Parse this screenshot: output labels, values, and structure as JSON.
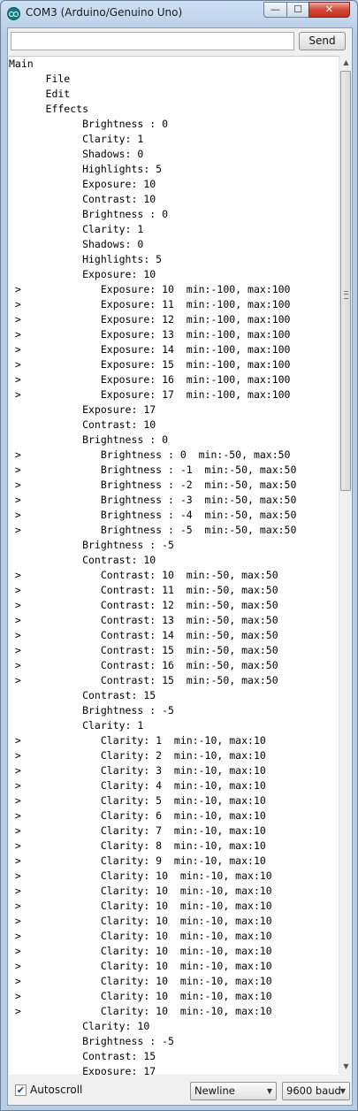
{
  "window": {
    "title": "COM3 (Arduino/Genuino Uno)",
    "controls": {
      "minimize": "—",
      "maximize": "☐",
      "close": "✕"
    }
  },
  "send": {
    "input_value": "",
    "button_label": "Send"
  },
  "console_lines": [
    "Main",
    "      File",
    "      Edit",
    "      Effects",
    "            Brightness : 0",
    "            Clarity: 1",
    "            Shadows: 0",
    "            Highlights: 5",
    "            Exposure: 10",
    "            Contrast: 10",
    "            Brightness : 0",
    "            Clarity: 1",
    "            Shadows: 0",
    "            Highlights: 5",
    "            Exposure: 10",
    " >             Exposure: 10  min:-100, max:100",
    " >             Exposure: 11  min:-100, max:100",
    " >             Exposure: 12  min:-100, max:100",
    " >             Exposure: 13  min:-100, max:100",
    " >             Exposure: 14  min:-100, max:100",
    " >             Exposure: 15  min:-100, max:100",
    " >             Exposure: 16  min:-100, max:100",
    " >             Exposure: 17  min:-100, max:100",
    "            Exposure: 17",
    "            Contrast: 10",
    "            Brightness : 0",
    " >             Brightness : 0  min:-50, max:50",
    " >             Brightness : -1  min:-50, max:50",
    " >             Brightness : -2  min:-50, max:50",
    " >             Brightness : -3  min:-50, max:50",
    " >             Brightness : -4  min:-50, max:50",
    " >             Brightness : -5  min:-50, max:50",
    "            Brightness : -5",
    "            Contrast: 10",
    " >             Contrast: 10  min:-50, max:50",
    " >             Contrast: 11  min:-50, max:50",
    " >             Contrast: 12  min:-50, max:50",
    " >             Contrast: 13  min:-50, max:50",
    " >             Contrast: 14  min:-50, max:50",
    " >             Contrast: 15  min:-50, max:50",
    " >             Contrast: 16  min:-50, max:50",
    " >             Contrast: 15  min:-50, max:50",
    "            Contrast: 15",
    "            Brightness : -5",
    "            Clarity: 1",
    " >             Clarity: 1  min:-10, max:10",
    " >             Clarity: 2  min:-10, max:10",
    " >             Clarity: 3  min:-10, max:10",
    " >             Clarity: 4  min:-10, max:10",
    " >             Clarity: 5  min:-10, max:10",
    " >             Clarity: 6  min:-10, max:10",
    " >             Clarity: 7  min:-10, max:10",
    " >             Clarity: 8  min:-10, max:10",
    " >             Clarity: 9  min:-10, max:10",
    " >             Clarity: 10  min:-10, max:10",
    " >             Clarity: 10  min:-10, max:10",
    " >             Clarity: 10  min:-10, max:10",
    " >             Clarity: 10  min:-10, max:10",
    " >             Clarity: 10  min:-10, max:10",
    " >             Clarity: 10  min:-10, max:10",
    " >             Clarity: 10  min:-10, max:10",
    " >             Clarity: 10  min:-10, max:10",
    " >             Clarity: 10  min:-10, max:10",
    " >             Clarity: 10  min:-10, max:10",
    "            Clarity: 10",
    "            Brightness : -5",
    "            Contrast: 15",
    "            Exposure: 17"
  ],
  "scrollbar": {
    "up_icon": "up-arrow-icon",
    "down_icon": "down-arrow-icon",
    "position": 0.0
  },
  "footer": {
    "autoscroll_label": "Autoscroll",
    "autoscroll_checked": true,
    "line_ending": "Newline",
    "baud_rate": "9600 baud"
  }
}
